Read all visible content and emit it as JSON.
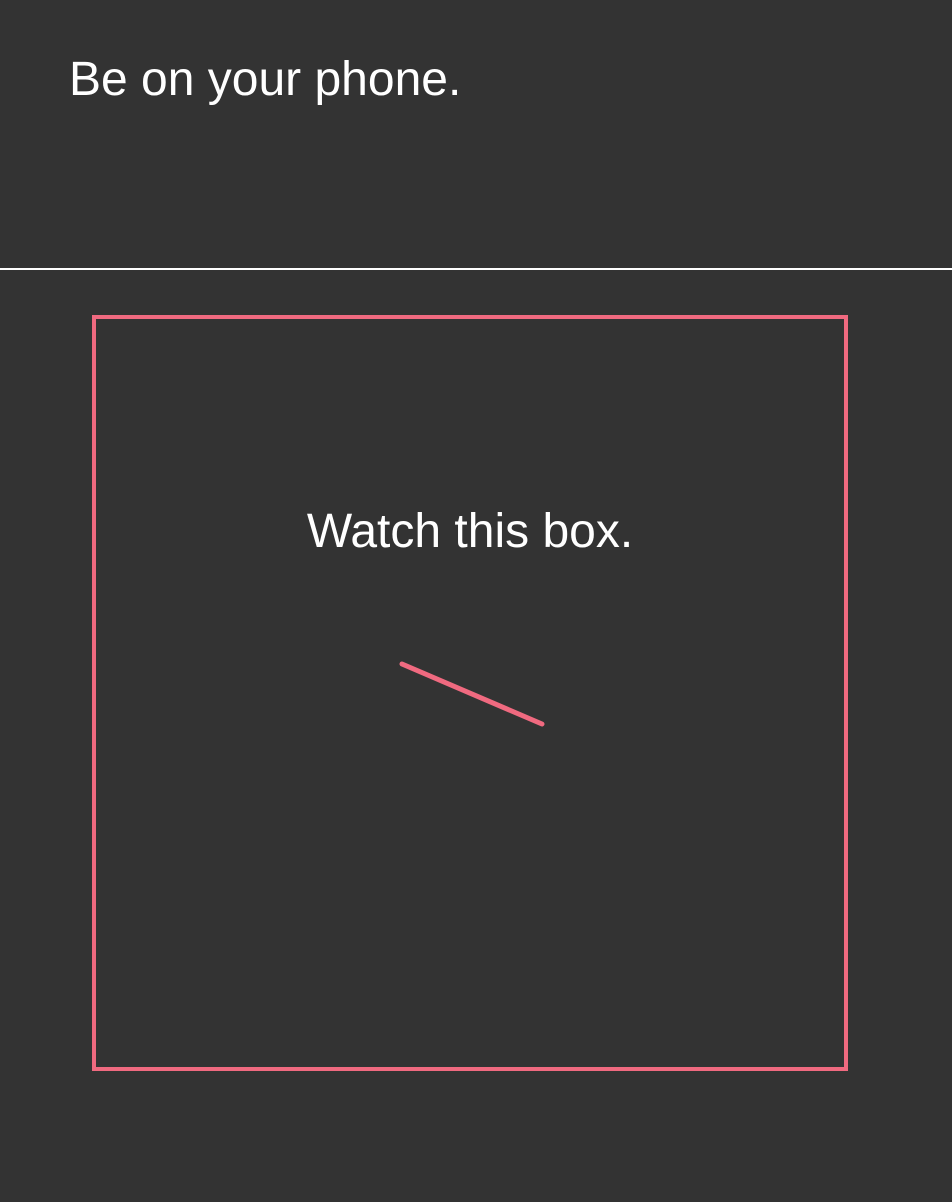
{
  "header": {
    "instruction": "Be on your phone."
  },
  "box": {
    "label": "Watch this box.",
    "accent_color": "#f06a80"
  },
  "colors": {
    "background": "#333333",
    "text": "#ffffff",
    "divider": "#ffffff"
  },
  "icons": {
    "indicator": "rotating-line-icon"
  }
}
